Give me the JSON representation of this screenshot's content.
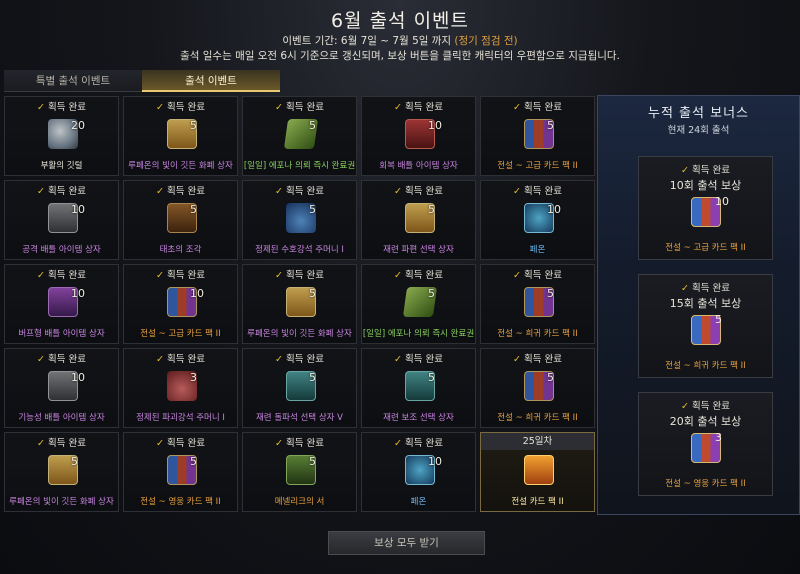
{
  "header": {
    "title": "6월 출석 이벤트",
    "period_prefix": "이벤트 기간: 6월 7일 ~ 7월 5일 까지",
    "period_maint": "(정기 점검 전)",
    "description": "출석 일수는 매일 오전 6시 기준으로 갱신되며, 보상 버튼을 클릭한 캐릭터의 우편함으로 지급됩니다."
  },
  "tabs": [
    {
      "label": "특별 출석 이벤트",
      "active": false
    },
    {
      "label": "출석 이벤트",
      "active": true
    }
  ],
  "claimed_label": "획득 완료",
  "days": [
    {
      "name": "부활의 깃털",
      "qty": "20",
      "icon": "feather-icon",
      "color": "white"
    },
    {
      "name": "루페온의 빛이 깃든 화폐 상자",
      "qty": "5",
      "icon": "chest-gold-icon",
      "color": "purple"
    },
    {
      "name": "[일일] 에포나 의뢰 즉시 완료권",
      "qty": "5",
      "icon": "scroll-green-icon",
      "color": "green"
    },
    {
      "name": "회복 배틀 아이템 상자",
      "qty": "10",
      "icon": "chest-red-icon",
      "color": "purple"
    },
    {
      "name": "전설 ~ 고급 카드 팩 II",
      "qty": "5",
      "icon": "cards-icon",
      "color": "orange"
    },
    {
      "name": "공격 배틀 아이템 상자",
      "qty": "10",
      "icon": "chest-gray-icon",
      "color": "purple"
    },
    {
      "name": "태초의 조각",
      "qty": "5",
      "icon": "book-brown-icon",
      "color": "purple"
    },
    {
      "name": "정제된 수호강석 주머니 I",
      "qty": "5",
      "icon": "bag-blue-icon",
      "color": "purple"
    },
    {
      "name": "재련 파편 선택 상자",
      "qty": "5",
      "icon": "chest-gold-icon",
      "color": "purple"
    },
    {
      "name": "페온",
      "qty": "10",
      "icon": "medal-icon",
      "color": "blue"
    },
    {
      "name": "버프형 배틀 아이템 상자",
      "qty": "10",
      "icon": "chest-purple-icon",
      "color": "purple"
    },
    {
      "name": "전설 ~ 고급 카드 팩 II",
      "qty": "10",
      "icon": "cards-icon",
      "color": "orange"
    },
    {
      "name": "루페온의 빛이 깃든 화폐 상자",
      "qty": "5",
      "icon": "chest-gold-icon",
      "color": "purple"
    },
    {
      "name": "[일일] 에포나 의뢰 즉시 완료권",
      "qty": "5",
      "icon": "scroll-green-icon",
      "color": "green"
    },
    {
      "name": "전설 ~ 희귀 카드 팩 II",
      "qty": "5",
      "icon": "cards-icon",
      "color": "orange"
    },
    {
      "name": "기능성 배틀 아이템 상자",
      "qty": "10",
      "icon": "chest-gray-icon",
      "color": "purple"
    },
    {
      "name": "정제된 파괴강석 주머니 I",
      "qty": "3",
      "icon": "bag-red-icon",
      "color": "purple"
    },
    {
      "name": "재련 돌파석 선택 상자 V",
      "qty": "5",
      "icon": "chest-teal-icon",
      "color": "purple"
    },
    {
      "name": "재련 보조 선택 상자",
      "qty": "5",
      "icon": "chest-teal-icon",
      "color": "purple"
    },
    {
      "name": "전설 ~ 희귀 카드 팩 II",
      "qty": "5",
      "icon": "cards-icon",
      "color": "orange"
    },
    {
      "name": "루페온의 빛이 깃든 화폐 상자",
      "qty": "5",
      "icon": "chest-gold-icon",
      "color": "purple"
    },
    {
      "name": "전설 ~ 영웅 카드 팩 II",
      "qty": "5",
      "icon": "cards-icon",
      "color": "orange"
    },
    {
      "name": "메넬리크의 서",
      "qty": "5",
      "icon": "book-green-icon",
      "color": "orange"
    },
    {
      "name": "페온",
      "qty": "10",
      "icon": "medal-icon",
      "color": "blue"
    },
    {
      "name": "전설 카드 팩 II",
      "qty": "",
      "icon": "legend-pack-icon",
      "color": "orange",
      "today_label": "25일차"
    }
  ],
  "side": {
    "title": "누적 출석 보너스",
    "count": "현재 24회 출석",
    "bonuses": [
      {
        "title": "10회 출석 보상",
        "qty": "10",
        "name": "전설 ~ 고급 카드 팩 II",
        "icon": "cards-icon"
      },
      {
        "title": "15회 출석 보상",
        "qty": "5",
        "name": "전설 ~ 희귀 카드 팩 II",
        "icon": "cards-icon"
      },
      {
        "title": "20회 출석 보상",
        "qty": "3",
        "name": "전설 ~ 영웅 카드 팩 II",
        "icon": "cards-icon"
      }
    ]
  },
  "footer": {
    "claim_all": "보상 모두 받기"
  }
}
